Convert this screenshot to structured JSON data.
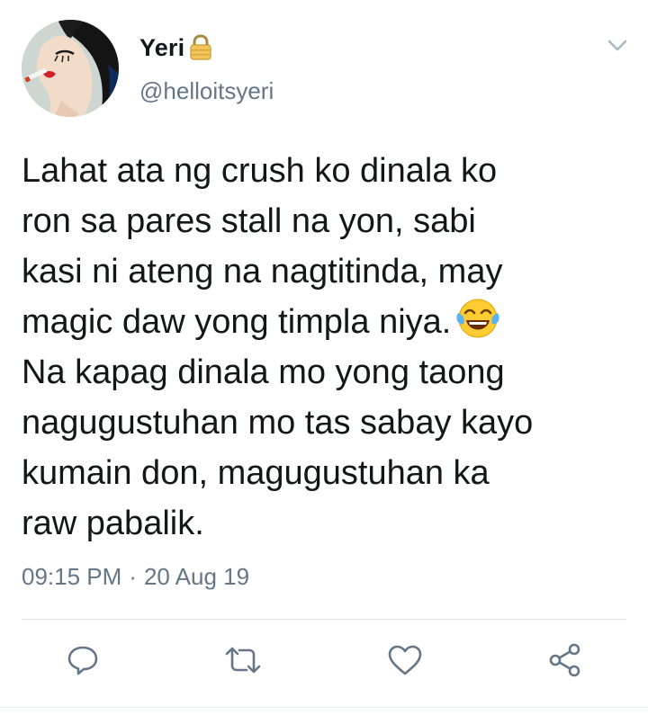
{
  "user": {
    "display_name": "Yeri",
    "handle": "@helloitsyeri",
    "protected_icon": "lock-icon",
    "avatar_icon": "avatar"
  },
  "tweet": {
    "lines": [
      "Lahat ata ng crush ko dinala ko",
      "ron sa pares stall na yon, sabi",
      "kasi ni ateng na nagtitinda, may",
      "magic daw yong timpla niya.",
      "Na kapag dinala mo yong taong",
      "nagugustuhan mo tas sabay kayo",
      "kumain don, magugustuhan ka",
      "raw pabalik."
    ],
    "emoji": "face-with-tears-of-joy",
    "time": "09:15 PM",
    "separator": "·",
    "date": "20 Aug 19"
  },
  "actions": {
    "reply": "reply-icon",
    "retweet": "retweet-icon",
    "like": "heart-icon",
    "share": "share-icon"
  },
  "colors": {
    "text": "#14171a",
    "secondary": "#657786",
    "icon": "#657786",
    "divider": "#dde3e8"
  }
}
